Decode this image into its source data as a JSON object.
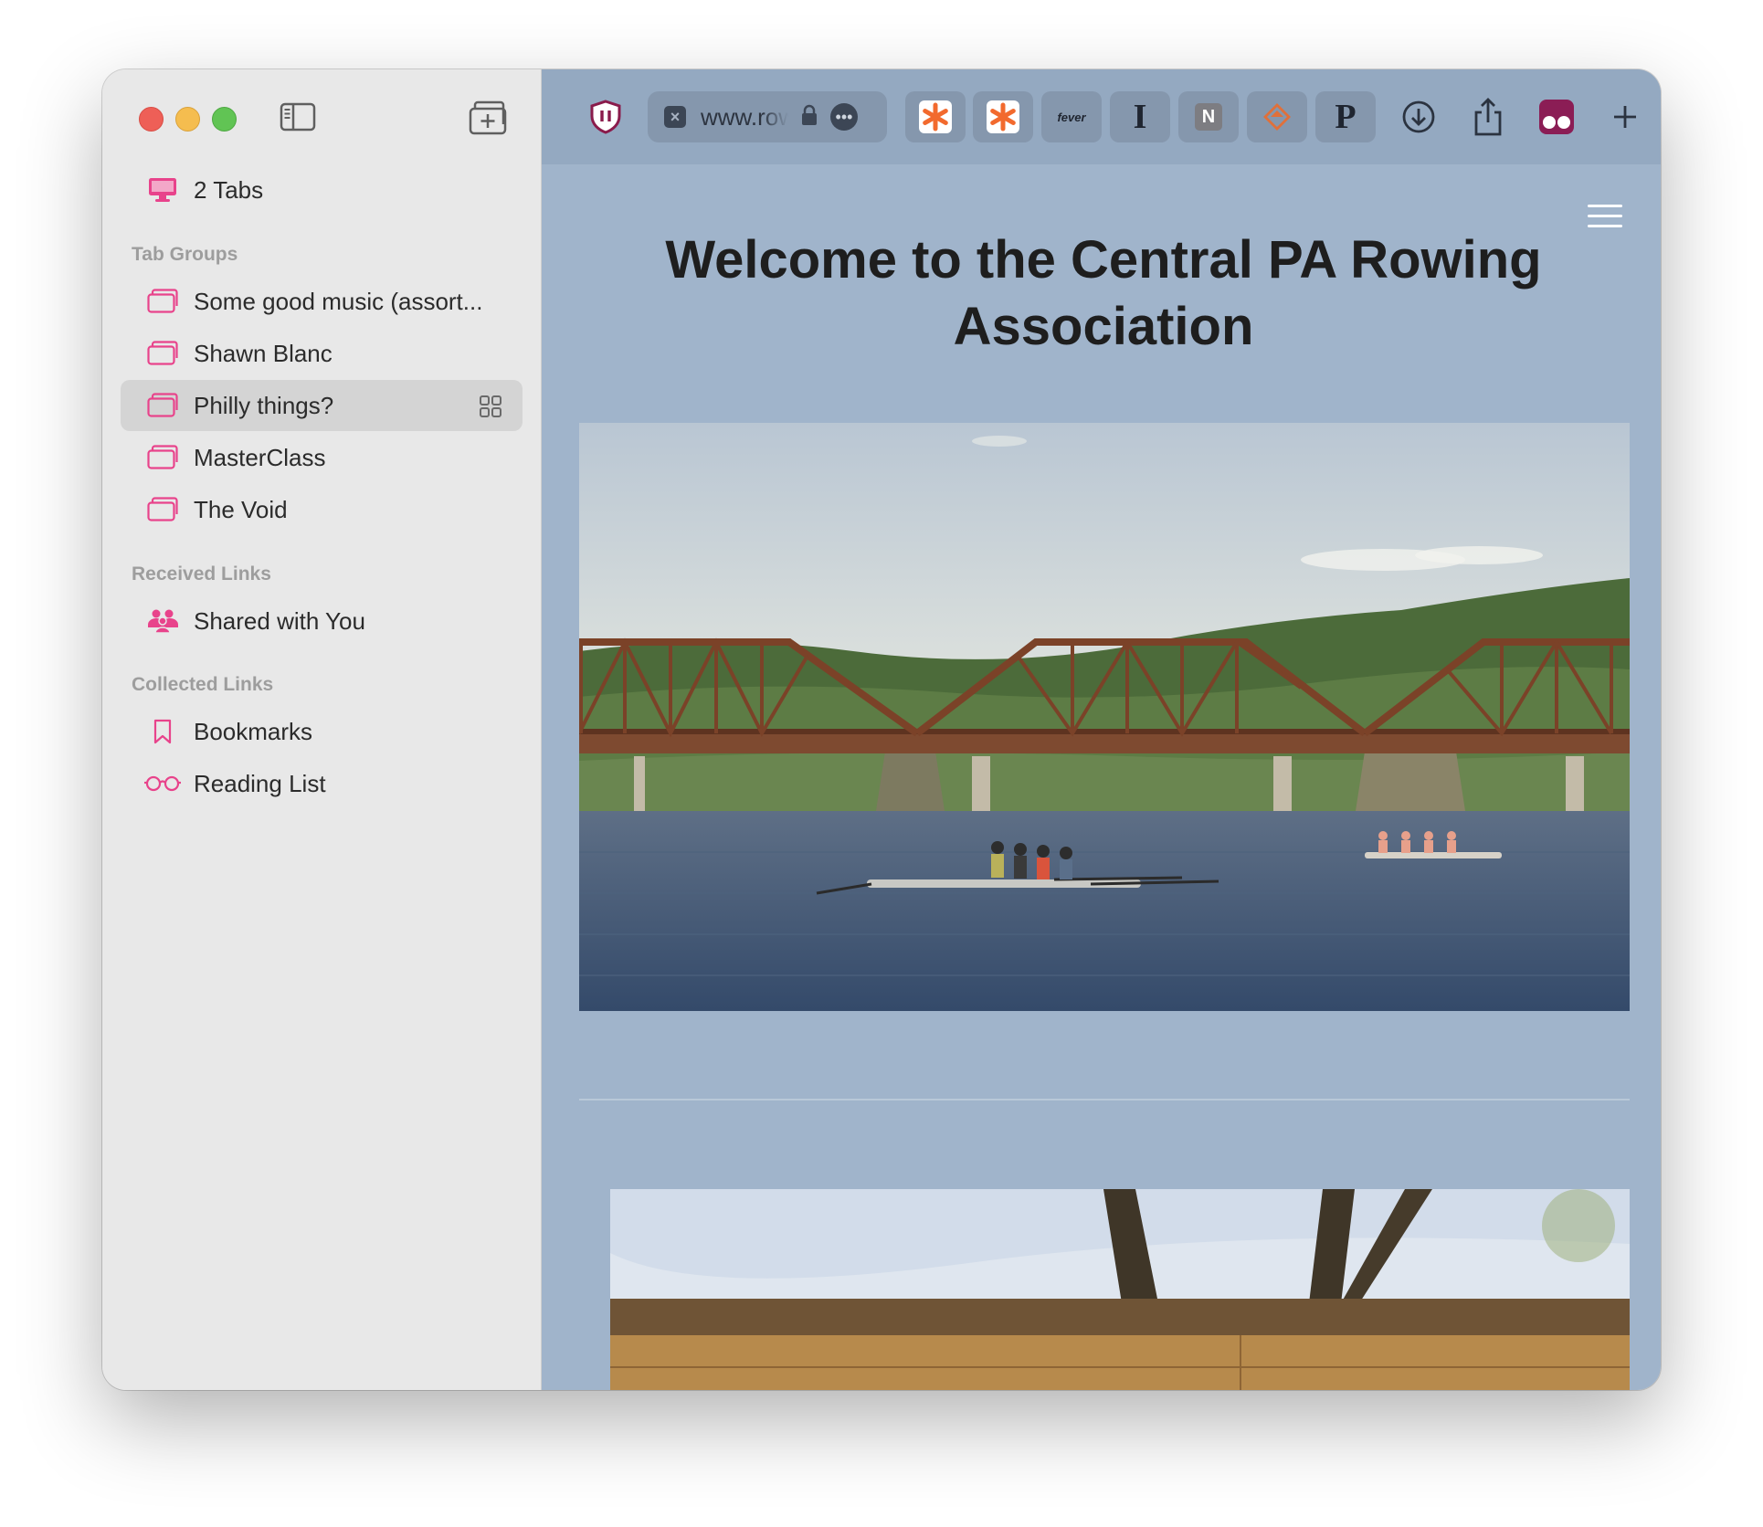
{
  "sidebar": {
    "tabs_item": {
      "label": "2 Tabs",
      "icon": "desktop-icon"
    },
    "tab_groups_header": "Tab Groups",
    "tab_groups": [
      {
        "label": "Some good music (assort...",
        "icon": "tab-group-icon",
        "selected": false
      },
      {
        "label": "Shawn Blanc",
        "icon": "tab-group-icon",
        "selected": false
      },
      {
        "label": "Philly things?",
        "icon": "tab-group-icon",
        "selected": true
      },
      {
        "label": "MasterClass",
        "icon": "tab-group-icon",
        "selected": false
      },
      {
        "label": "The Void",
        "icon": "tab-group-icon",
        "selected": false
      }
    ],
    "received_header": "Received Links",
    "shared": {
      "label": "Shared with You",
      "icon": "people-icon"
    },
    "collected_header": "Collected Links",
    "bookmarks": {
      "label": "Bookmarks",
      "icon": "bookmark-icon"
    },
    "reading_list": {
      "label": "Reading List",
      "icon": "glasses-icon"
    }
  },
  "toolbar": {
    "url": "www.rowing",
    "extensions": [
      {
        "name": "asterisk-orange-icon"
      },
      {
        "name": "asterisk-orange-icon"
      },
      {
        "name": "fever-icon",
        "text": "fever"
      },
      {
        "name": "instapaper-icon",
        "text": "I"
      },
      {
        "name": "notion-icon",
        "text": "N"
      },
      {
        "name": "diamond-icon"
      },
      {
        "name": "pinboard-icon",
        "text": "P"
      }
    ]
  },
  "page": {
    "title": "Welcome to the Central PA Rowing Association"
  },
  "colors": {
    "accent": "#e8438b",
    "page_bg": "#a0b4cb",
    "toolbar_bg": "#94a9c1",
    "sidebar_bg": "#e8e8e8"
  }
}
